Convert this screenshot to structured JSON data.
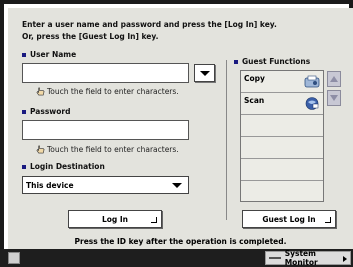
{
  "instructions": {
    "line1": "Enter a user name and password and press the [Log In] key.",
    "line2": "Or, press the [Guest Log In] key."
  },
  "user_name": {
    "label": "User Name",
    "value": "",
    "hint": "Touch the field to enter characters."
  },
  "password": {
    "label": "Password",
    "value": "",
    "hint": "Touch the field to enter characters."
  },
  "login_destination": {
    "label": "Login Destination",
    "selected": "This device"
  },
  "guest_functions": {
    "label": "Guest Functions",
    "items": [
      {
        "label": "Copy",
        "icon": "copy-icon"
      },
      {
        "label": "Scan",
        "icon": "scan-icon"
      },
      {
        "label": ""
      },
      {
        "label": ""
      },
      {
        "label": ""
      },
      {
        "label": ""
      }
    ]
  },
  "buttons": {
    "login": "Log In",
    "guest_login": "Guest Log In"
  },
  "footer_message": "Press the ID key after the operation is completed.",
  "status_bar": {
    "system_monitor": "System Monitor"
  }
}
